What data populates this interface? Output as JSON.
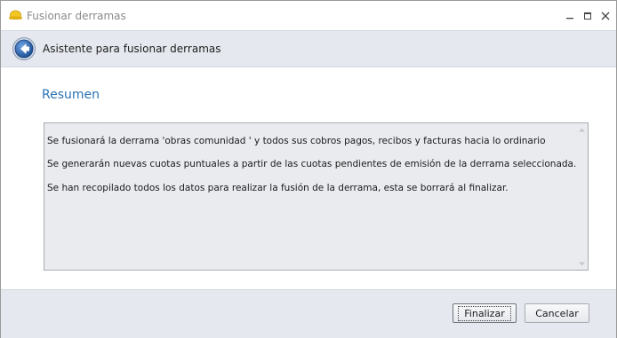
{
  "window": {
    "title": "Fusionar derramas",
    "controls": {
      "minimize": "–",
      "maximize": "□",
      "close": "✕"
    }
  },
  "header": {
    "title": "Asistente para fusionar derramas",
    "back_icon": "back-arrow-icon"
  },
  "content": {
    "section_title": "Resumen",
    "lines": [
      "Se fusionará la derrama 'obras comunidad ' y todos sus cobros pagos, recibos y facturas hacia lo ordinario",
      "Se generarán nuevas cuotas puntuales a partir de las cuotas pendientes de emisión de la derrama seleccionada.",
      "Se han recopilado todos los datos para realizar la fusión de la derrama, esta se borrará al finalizar."
    ]
  },
  "footer": {
    "finish_label": "Finalizar",
    "cancel_label": "Cancelar"
  },
  "colors": {
    "accent": "#2a72b5",
    "header_bg": "#e5e8ee",
    "textbox_bg": "#e9ebef"
  }
}
